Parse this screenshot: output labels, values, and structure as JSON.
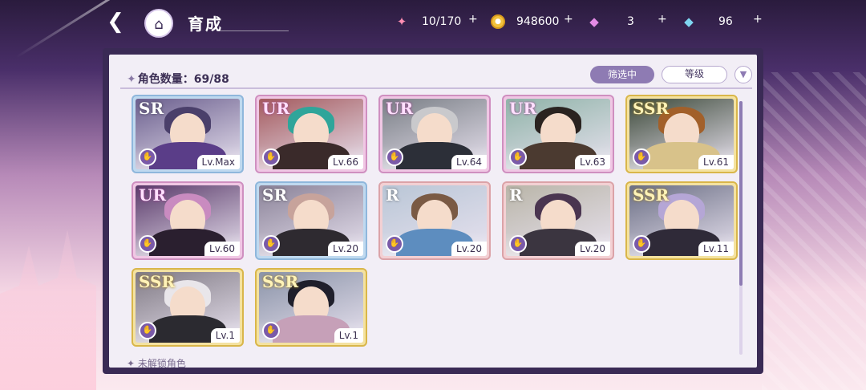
{
  "header": {
    "title": "育成",
    "candy": "10/170",
    "coins": "948600",
    "pink_gems": "3",
    "blue_gems": "96",
    "plus": "+"
  },
  "panel": {
    "count_label": "角色数量：69/88",
    "filter_label": "筛选中",
    "sort_label": "等级",
    "locked_label": "未解锁角色"
  },
  "cards": [
    {
      "rarity": "SR",
      "level": "Lv.Max",
      "bg": "#6b5f8e",
      "hair": "#4a3f6a",
      "body": "#5a3d88"
    },
    {
      "rarity": "UR",
      "level": "Lv.66",
      "bg": "#a45a5e",
      "hair": "#2fa59a",
      "body": "#3a2a2a"
    },
    {
      "rarity": "UR",
      "level": "Lv.64",
      "bg": "#7a7f86",
      "hair": "#c9c9cc",
      "body": "#2c2f38"
    },
    {
      "rarity": "UR",
      "level": "Lv.63",
      "bg": "#8fb3a8",
      "hair": "#2a2320",
      "body": "#4b3a30"
    },
    {
      "rarity": "SSR",
      "level": "Lv.61",
      "bg": "#3d4a3a",
      "hair": "#a2602a",
      "body": "#d8c28a"
    },
    {
      "rarity": "UR",
      "level": "Lv.60",
      "bg": "#5a3a6a",
      "hair": "#c98bc0",
      "body": "#2a1f2f"
    },
    {
      "rarity": "SR",
      "level": "Lv.20",
      "bg": "#8a8298",
      "hair": "#c7a39b",
      "body": "#2e2a30"
    },
    {
      "rarity": "R",
      "level": "Lv.20",
      "bg": "#b9c6d6",
      "hair": "#7a5a44",
      "body": "#5d8dbf"
    },
    {
      "rarity": "R",
      "level": "Lv.20",
      "bg": "#b9b5a8",
      "hair": "#4a3550",
      "body": "#3b3540"
    },
    {
      "rarity": "SSR",
      "level": "Lv.11",
      "bg": "#6a6e84",
      "hair": "#b5a6d6",
      "body": "#2f2a38"
    },
    {
      "rarity": "SSR",
      "level": "Lv.1",
      "bg": "#807a84",
      "hair": "#e9e6ea",
      "body": "#2b2a30"
    },
    {
      "rarity": "SSR",
      "level": "Lv.1",
      "bg": "#8a93a8",
      "hair": "#1f1f2b",
      "body": "#c6a0b8"
    }
  ]
}
